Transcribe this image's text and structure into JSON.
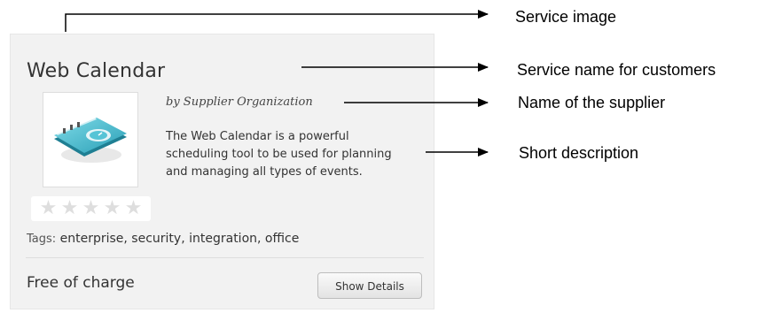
{
  "card": {
    "title": "Web Calendar",
    "supplier": "by Supplier Organization",
    "description": "The Web Calendar is a powerful scheduling tool to be used for planning and managing all types of events.",
    "rating": {
      "value": 0,
      "max": 5
    },
    "tags_label": "Tags:",
    "tags": "enterprise, security, integration, office",
    "price": "Free of charge",
    "details_button": "Show Details"
  },
  "annotations": {
    "service_image": "Service image",
    "service_name": "Service name for customers",
    "supplier_name": "Name of the supplier",
    "short_description": "Short description"
  },
  "colors": {
    "card_background": "#f2f2f2",
    "star_empty": "#dedede",
    "icon_teal": "#3db4c8"
  }
}
